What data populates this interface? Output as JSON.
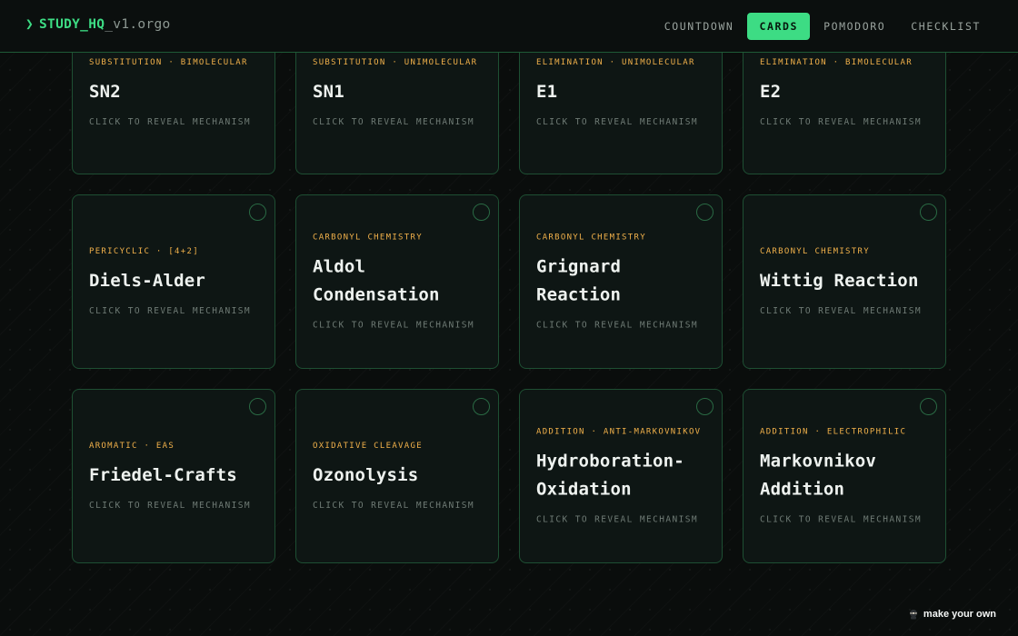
{
  "brand": {
    "chevron": "❯",
    "name": "STUDY_HQ",
    "suffix": "_v1.orgo"
  },
  "nav": {
    "tabs": [
      {
        "label": "COUNTDOWN",
        "active": false
      },
      {
        "label": "CARDS",
        "active": true
      },
      {
        "label": "POMODORO",
        "active": false
      },
      {
        "label": "CHECKLIST",
        "active": false
      }
    ]
  },
  "cards": [
    {
      "category": "SUBSTITUTION · BIMOLECULAR",
      "title": "SN2",
      "hint": "CLICK TO REVEAL MECHANISM"
    },
    {
      "category": "SUBSTITUTION · UNIMOLECULAR",
      "title": "SN1",
      "hint": "CLICK TO REVEAL MECHANISM"
    },
    {
      "category": "ELIMINATION · UNIMOLECULAR",
      "title": "E1",
      "hint": "CLICK TO REVEAL MECHANISM"
    },
    {
      "category": "ELIMINATION · BIMOLECULAR",
      "title": "E2",
      "hint": "CLICK TO REVEAL MECHANISM"
    },
    {
      "category": "PERICYCLIC · [4+2]",
      "title": "Diels-Alder",
      "hint": "CLICK TO REVEAL MECHANISM"
    },
    {
      "category": "CARBONYL CHEMISTRY",
      "title": "Aldol Condensation",
      "hint": "CLICK TO REVEAL MECHANISM"
    },
    {
      "category": "CARBONYL CHEMISTRY",
      "title": "Grignard Reaction",
      "hint": "CLICK TO REVEAL MECHANISM"
    },
    {
      "category": "CARBONYL CHEMISTRY",
      "title": "Wittig Reaction",
      "hint": "CLICK TO REVEAL MECHANISM"
    },
    {
      "category": "AROMATIC · EAS",
      "title": "Friedel-Crafts",
      "hint": "CLICK TO REVEAL MECHANISM"
    },
    {
      "category": "OXIDATIVE CLEAVAGE",
      "title": "Ozonolysis",
      "hint": "CLICK TO REVEAL MECHANISM"
    },
    {
      "category": "ADDITION · ANTI-MARKOVNIKOV",
      "title": "Hydroboration-Oxidation",
      "hint": "CLICK TO REVEAL MECHANISM"
    },
    {
      "category": "ADDITION · ELECTROPHILIC",
      "title": "Markovnikov Addition",
      "hint": "CLICK TO REVEAL MECHANISM"
    }
  ],
  "footer": {
    "icon": "ninja-icon",
    "label": "make your own"
  },
  "colors": {
    "accent": "#3ddc84",
    "category": "#f0b04a",
    "card_border": "#1e4f33"
  }
}
